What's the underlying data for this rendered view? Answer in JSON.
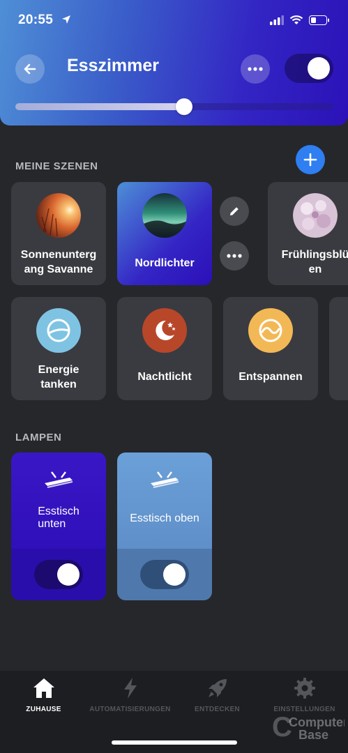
{
  "status_bar": {
    "time": "20:55"
  },
  "header": {
    "title": "Esszimmer",
    "brightness": 0.53,
    "power_on": true
  },
  "scenes_section": {
    "label": "MEINE SZENEN"
  },
  "scenes_row1": [
    {
      "label": "Sonnenunterg\nang Savanne"
    },
    {
      "label": "Nordlichter",
      "active": true
    },
    {
      "label": "Frühlingsblü\nen"
    }
  ],
  "scenes_row2": [
    {
      "label": "Energie\ntanken",
      "color": "#7fc3e3"
    },
    {
      "label": "Nachtlicht",
      "color": "#b8472a"
    },
    {
      "label": "Entspannen",
      "color": "#f3b856"
    }
  ],
  "lamps_section": {
    "label": "LAMPEN"
  },
  "lamps": [
    {
      "label": "Esstisch\nunten",
      "on": true
    },
    {
      "label": "Esstisch oben",
      "on": true
    }
  ],
  "tabs": [
    {
      "label": "ZUHAUSE",
      "icon": "home-icon",
      "active": true
    },
    {
      "label": "AUTOMATISIERUNGEN",
      "icon": "lightning-icon",
      "active": false
    },
    {
      "label": "ENTDECKEN",
      "icon": "rocket-icon",
      "active": false
    },
    {
      "label": "EINSTELLUNGEN",
      "icon": "gear-icon",
      "active": false
    }
  ],
  "watermark": {
    "line1": "Computer",
    "line2": "Base"
  }
}
